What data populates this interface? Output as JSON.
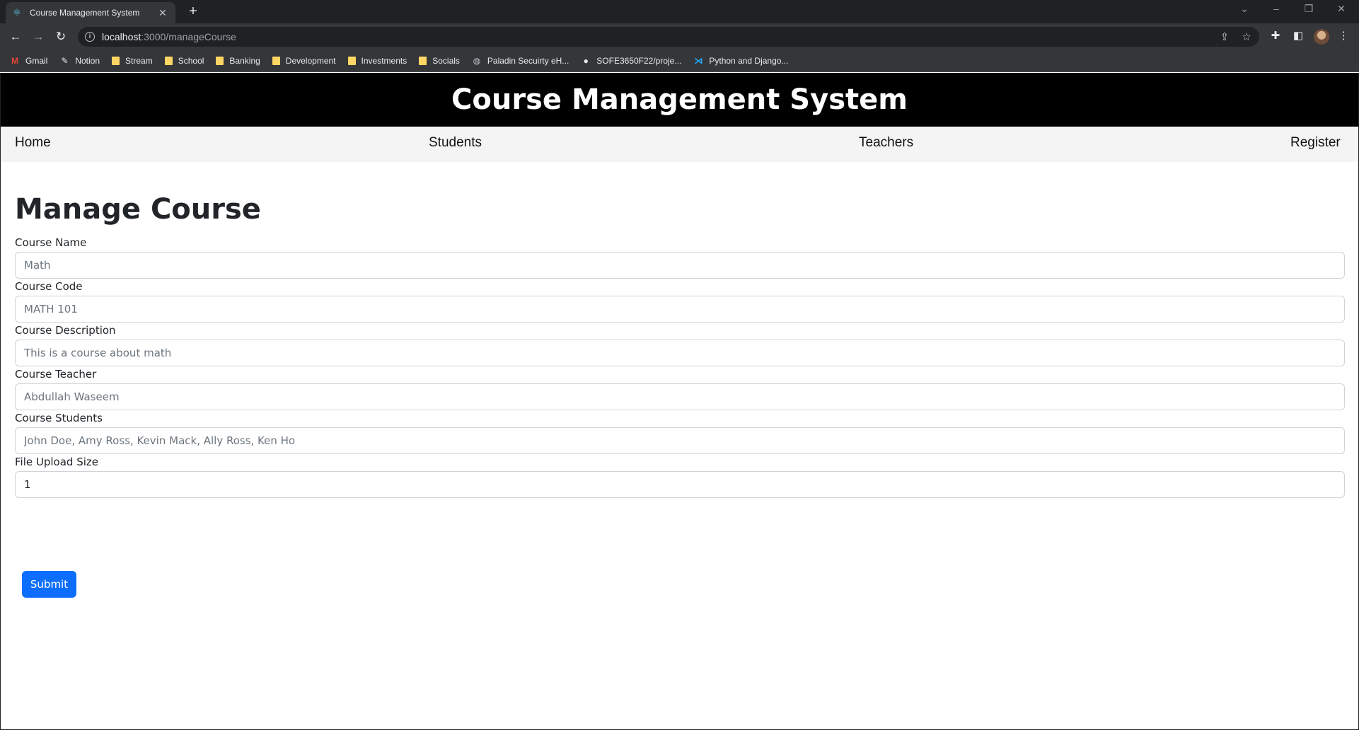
{
  "browser": {
    "tab_title": "Course Management System",
    "url_host": "localhost",
    "url_rest": ":3000/manageCourse",
    "bookmarks": [
      {
        "label": "Gmail",
        "icon": "gmail-icon"
      },
      {
        "label": "Notion",
        "icon": "notion-icon"
      },
      {
        "label": "Stream",
        "icon": "folder-icon"
      },
      {
        "label": "School",
        "icon": "folder-icon"
      },
      {
        "label": "Banking",
        "icon": "folder-icon"
      },
      {
        "label": "Development",
        "icon": "folder-icon"
      },
      {
        "label": "Investments",
        "icon": "folder-icon"
      },
      {
        "label": "Socials",
        "icon": "folder-icon"
      },
      {
        "label": "Paladin Secuirty eH...",
        "icon": "globe-icon"
      },
      {
        "label": "SOFE3650F22/proje...",
        "icon": "github-icon"
      },
      {
        "label": "Python and Django...",
        "icon": "vscode-icon"
      }
    ]
  },
  "app": {
    "title": "Course Management System",
    "nav": {
      "home": "Home",
      "students": "Students",
      "teachers": "Teachers",
      "register": "Register"
    }
  },
  "form": {
    "heading": "Manage Course",
    "fields": [
      {
        "label": "Course Name",
        "placeholder": "Math",
        "value": ""
      },
      {
        "label": "Course Code",
        "placeholder": "MATH 101",
        "value": ""
      },
      {
        "label": "Course Description",
        "placeholder": "This is a course about math",
        "value": ""
      },
      {
        "label": "Course Teacher",
        "placeholder": "Abdullah Waseem",
        "value": ""
      },
      {
        "label": "Course Students",
        "placeholder": "John Doe, Amy Ross, Kevin Mack, Ally Ross, Ken Ho",
        "value": ""
      },
      {
        "label": "File Upload Size",
        "placeholder": "",
        "value": "1"
      }
    ],
    "submit_label": "Submit"
  },
  "colors": {
    "header_bg": "#000000",
    "nav_bg": "#f4f4f4",
    "primary": "#0d6efd"
  }
}
